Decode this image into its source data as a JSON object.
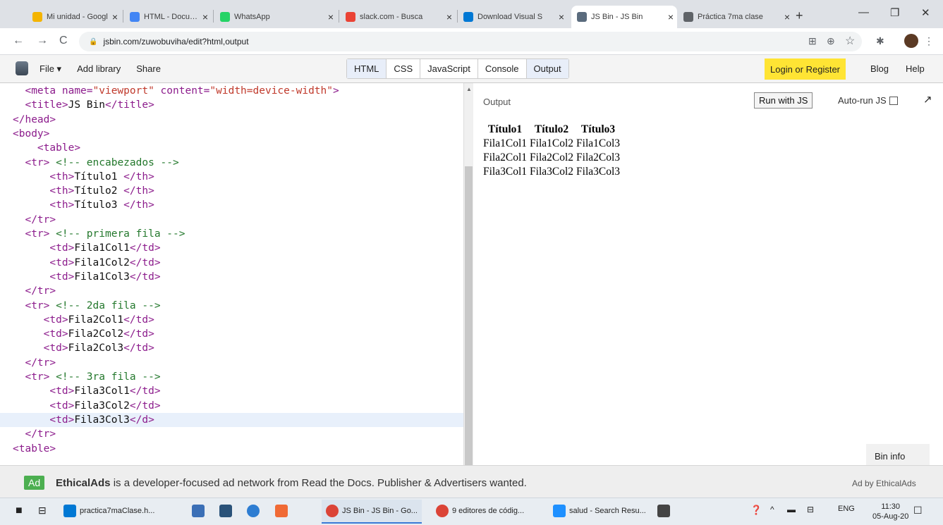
{
  "browser": {
    "tabs": [
      {
        "title": "Mi unidad - Googl",
        "color": "#f4b400",
        "active": false
      },
      {
        "title": "HTML - Document",
        "color": "#4285f4",
        "active": false
      },
      {
        "title": "WhatsApp",
        "color": "#25d366",
        "active": false
      },
      {
        "title": "slack.com - Busca",
        "color": "#ea4335",
        "active": false
      },
      {
        "title": "Download Visual S",
        "color": "#0078d4",
        "active": false
      },
      {
        "title": "JS Bin - JS Bin",
        "color": "#5a6b7d",
        "active": true
      },
      {
        "title": "Práctica 7ma clase",
        "color": "#5f6368",
        "active": false
      }
    ],
    "new_tab": "+",
    "controls": {
      "minimize": "—",
      "maximize": "❐",
      "close": "✕"
    },
    "url": "jsbin.com/zuwobuviha/edit?html,output",
    "nav": {
      "back": "←",
      "forward": "→",
      "reload": "C"
    },
    "icons": [
      "translate-icon",
      "zoom-icon",
      "star-icon",
      "extension-icon",
      "menu-icon"
    ]
  },
  "jsbin": {
    "menu": [
      "File ▾",
      "Add library",
      "Share"
    ],
    "panels": [
      {
        "label": "HTML",
        "on": true
      },
      {
        "label": "CSS",
        "on": false
      },
      {
        "label": "JavaScript",
        "on": false
      },
      {
        "label": "Console",
        "on": false
      },
      {
        "label": "Output",
        "on": true
      }
    ],
    "login": "Login or Register",
    "blog": "Blog",
    "help": "Help"
  },
  "editor": {
    "lines": [
      "  <meta name=\"viewport\" content=\"width=device-width\">",
      "  <title>JS Bin</title>",
      "</head>",
      "<body>",
      "    <table>",
      "  <tr> <!-- encabezados -->",
      "      <th>Título1 </th>",
      "      <th>Título2 </th>",
      "      <th>Título3 </th>",
      "  </tr>",
      "  <tr> <!-- primera fila -->",
      "      <td>Fila1Col1</td>",
      "      <td>Fila1Col2</td>",
      "      <td>Fila1Col3</td>",
      "  </tr>",
      "  <tr> <!-- 2da fila -->",
      "     <td>Fila2Col1</td>",
      "     <td>Fila2Col2</td>",
      "     <td>Fila2Col3</td>",
      "  </tr>",
      "  <tr> <!-- 3ra fila -->",
      "      <td>Fila3Col1</td>",
      "      <td>Fila3Col2</td>",
      "      <td>Fila3Col3</d>",
      "  </tr>",
      "<table>"
    ],
    "active_line": 23
  },
  "output": {
    "label": "Output",
    "run_button": "Run with JS",
    "autorun_label": "Auto-run JS",
    "popout": "↗",
    "table": {
      "headers": [
        "Título1",
        "Título2",
        "Título3"
      ],
      "rows": [
        [
          "Fila1Col1",
          "Fila1Col2",
          "Fila1Col3"
        ],
        [
          "Fila2Col1",
          "Fila2Col2",
          "Fila2Col3"
        ],
        [
          "Fila3Col1",
          "Fila3Col2",
          "Fila3Col3"
        ]
      ]
    },
    "bin_info": "Bin info"
  },
  "ad": {
    "badge": "Ad",
    "brand": "EthicalAds",
    "text": " is a developer-focused ad network from Read the Docs. Publisher & Advertisers wanted.",
    "by": "Ad by EthicalAds"
  },
  "taskbar": {
    "items": [
      {
        "label": "practica7maClase.h...",
        "color": "#0078d4"
      },
      {
        "label": "JS Bin - JS Bin - Go...",
        "color": "#db4437"
      },
      {
        "label": "9 editores de códig...",
        "color": "#db4437"
      },
      {
        "label": "salud - Search Resu...",
        "color": "#1e90ff"
      }
    ],
    "lang": "ENG",
    "time": "11:30",
    "date": "05-Aug-20"
  }
}
